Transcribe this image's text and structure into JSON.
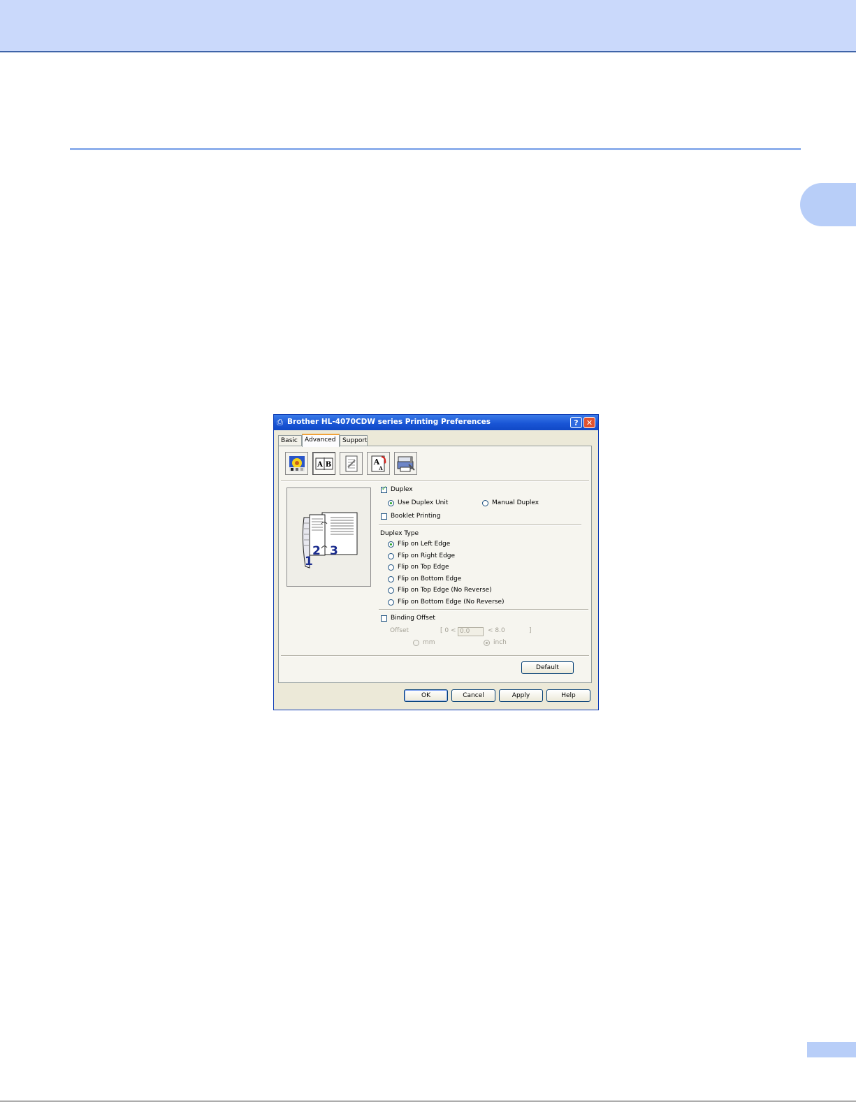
{
  "dialog": {
    "title": "Brother HL-4070CDW series Printing Preferences",
    "help_label": "?",
    "close_label": "✕",
    "tabs": [
      {
        "label": "Basic"
      },
      {
        "label": "Advanced"
      },
      {
        "label": "Support"
      }
    ],
    "active_tab": "Advanced",
    "toolbar_icons": [
      "color-settings-icon",
      "duplex-icon",
      "watermark-icon",
      "page-setting-icon",
      "device-options-icon"
    ],
    "duplex": {
      "label": "Duplex",
      "checked": true,
      "use_duplex_unit_label": "Use Duplex Unit",
      "manual_duplex_label": "Manual Duplex",
      "selected_mode": "Use Duplex Unit"
    },
    "booklet": {
      "label": "Booklet Printing",
      "checked": false
    },
    "duplex_type": {
      "heading": "Duplex Type",
      "options": [
        "Flip on Left Edge",
        "Flip on Right Edge",
        "Flip on Top Edge",
        "Flip on Bottom Edge",
        "Flip on Top Edge (No Reverse)",
        "Flip on Bottom Edge (No Reverse)"
      ],
      "selected": "Flip on Left Edge"
    },
    "binding_offset": {
      "label": "Binding Offset",
      "checked": false,
      "offset_label": "Offset",
      "range_open": "[ 0 <",
      "value": "0.0",
      "range_close": "<   8.0",
      "range_end": "]",
      "unit_mm": "mm",
      "unit_inch": "inch",
      "selected_unit": "inch"
    },
    "preview": {
      "page_numbers": [
        "1",
        "2",
        "3"
      ]
    },
    "buttons": {
      "default": "Default",
      "ok": "OK",
      "cancel": "Cancel",
      "apply": "Apply",
      "help": "Help"
    }
  },
  "colors": {
    "header_band": "#cad9fb",
    "accent_rule": "#8fb0ec",
    "titlebar": "#1a56d6",
    "dialog_bg": "#ece9d8"
  }
}
